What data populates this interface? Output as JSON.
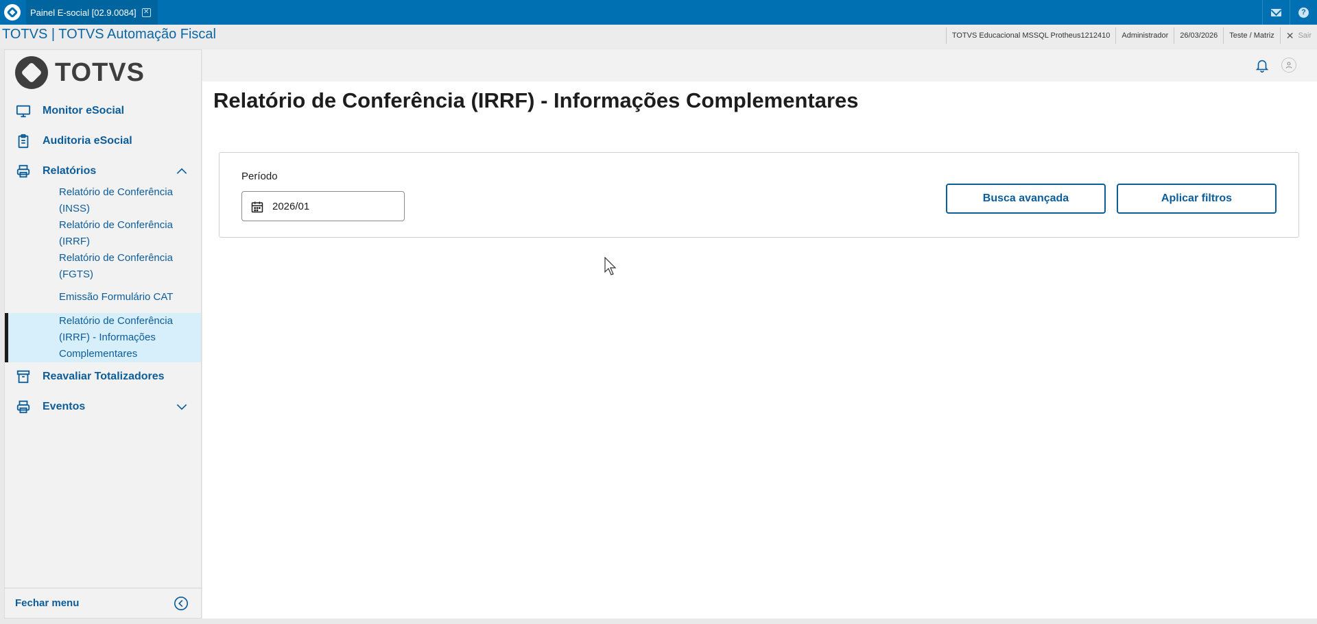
{
  "topbar": {
    "tab_label": "Painel E-social [02.9.0084]",
    "tab_close_icon": "close-icon",
    "mail_icon": "mail-icon",
    "help_icon": "help-icon"
  },
  "infobar": {
    "app_title": "TOTVS | TOTVS Automação Fiscal",
    "environment": "TOTVS Educacional MSSQL Protheus1212410",
    "user": "Administrador",
    "date": "26/03/2026",
    "branch": "Teste / Matriz",
    "exit_label": "Sair"
  },
  "sidebar": {
    "logo_text": "TOTVS",
    "items": [
      {
        "label": "Monitor eSocial",
        "icon": "monitor-icon"
      },
      {
        "label": "Auditoria eSocial",
        "icon": "clipboard-icon"
      },
      {
        "label": "Relatórios",
        "icon": "printer-icon",
        "expanded": true
      },
      {
        "label": "Reavaliar Totalizadores",
        "icon": "archive-icon"
      },
      {
        "label": "Eventos",
        "icon": "printer-icon",
        "expanded": false
      }
    ],
    "subitems": [
      {
        "line1": "Relatório de Conferência",
        "line2": "(INSS)"
      },
      {
        "line1": "Relatório de Conferência",
        "line2": "(IRRF)"
      },
      {
        "line1": "Relatório de Conferência",
        "line2": "(FGTS)"
      },
      {
        "line1": "Emissão Formulário CAT"
      },
      {
        "line1": "Relatório de Conferência",
        "line2": "(IRRF) - Informações",
        "line3": "Complementares",
        "active": true
      }
    ],
    "footer_label": "Fechar menu"
  },
  "main": {
    "page_title": "Relatório de Conferência (IRRF) - Informações Complementares",
    "filter": {
      "period_label": "Período",
      "period_value": "2026/01",
      "busca_label": "Busca avançada",
      "aplicar_label": "Aplicar filtros"
    }
  },
  "colors": {
    "topbar": "#0070b2",
    "brand_text": "#0b5d9a",
    "active_background": "#d7eefb"
  }
}
